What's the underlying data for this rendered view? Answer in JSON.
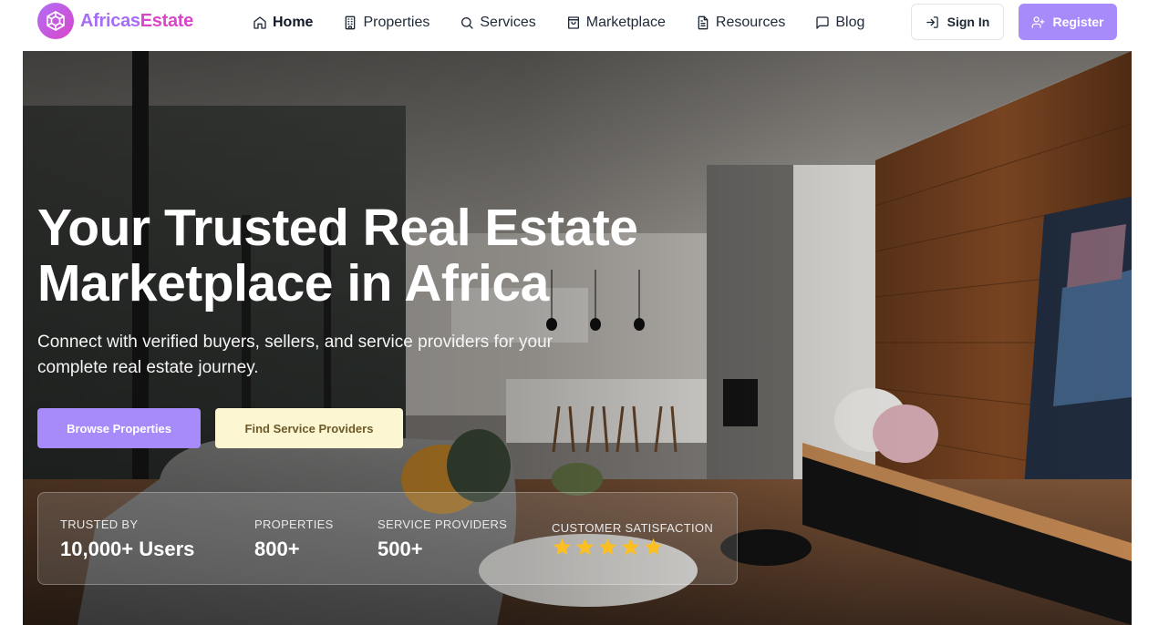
{
  "brand": {
    "name_part1": "Africas",
    "name_part2": "Estate",
    "logo_icon": "hexagon-cube-icon"
  },
  "nav": {
    "items": [
      {
        "label": "Home",
        "icon": "home-icon",
        "active": true
      },
      {
        "label": "Properties",
        "icon": "building-icon",
        "active": false
      },
      {
        "label": "Services",
        "icon": "search-icon",
        "active": false
      },
      {
        "label": "Marketplace",
        "icon": "shopping-bag-icon",
        "active": false
      },
      {
        "label": "Resources",
        "icon": "document-icon",
        "active": false
      },
      {
        "label": "Blog",
        "icon": "message-square-icon",
        "active": false
      }
    ],
    "signin_label": "Sign In",
    "register_label": "Register"
  },
  "hero": {
    "title_line1": "Your Trusted Real Estate",
    "title_line2": "Marketplace in Africa",
    "subtitle": "Connect with verified buyers, sellers, and service providers for your complete real estate journey.",
    "primary_cta": "Browse Properties",
    "secondary_cta": "Find Service Providers"
  },
  "stats": [
    {
      "label": "TRUSTED BY",
      "value": "10,000+ Users"
    },
    {
      "label": "PROPERTIES",
      "value": "800+"
    },
    {
      "label": "SERVICE PROVIDERS",
      "value": "500+"
    },
    {
      "label": "CUSTOMER SATISFACTION",
      "rating": 5,
      "max_rating": 5
    }
  ],
  "colors": {
    "accent": "#a78bfa",
    "brand_gradient_start": "#a66ef8",
    "brand_gradient_end": "#d946c9",
    "secondary_button": "#fdf6d3",
    "star": "#fbbf24"
  }
}
